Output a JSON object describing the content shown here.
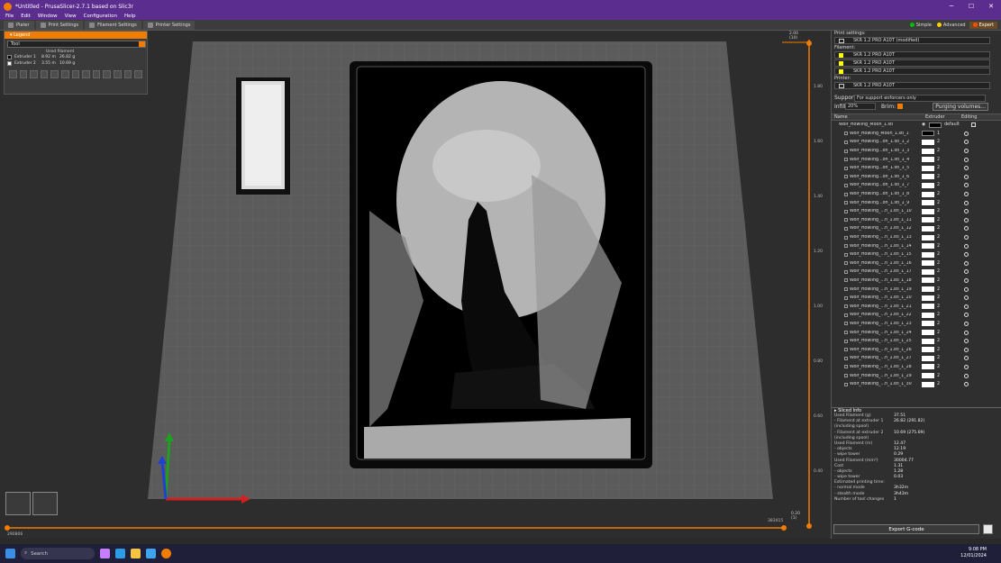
{
  "window": {
    "title": "*Untitled - PrusaSlicer-2.7.1 based on Slic3r"
  },
  "menu": [
    "File",
    "Edit",
    "Window",
    "View",
    "Configuration",
    "Help"
  ],
  "tabs": [
    "Plater",
    "Print Settings",
    "Filament Settings",
    "Printer Settings"
  ],
  "modes": {
    "simple": "Simple",
    "advanced": "Advanced",
    "expert": "Expert"
  },
  "colors": {
    "accent": "#f07d00",
    "titlebar": "#5b2d8e",
    "simple": "#00c000",
    "advanced": "#ffd000",
    "expert": "#ff4d00"
  },
  "legend": {
    "header": "Legend",
    "selector": "Tool",
    "used_header": "Used filament",
    "extruders": [
      {
        "label": "Extruder 1",
        "m": "8.92 m",
        "g": "26.82 g",
        "color": "#000000"
      },
      {
        "label": "Extruder 2",
        "m": "3.55 m",
        "g": "10.69 g",
        "color": "#ffffff"
      }
    ]
  },
  "vslider": {
    "ticks": [
      "2.00",
      "1.80",
      "1.60",
      "1.40",
      "1.20",
      "1.00",
      "0.80",
      "0.60",
      "0.40",
      "0.20"
    ],
    "top_label": "(10)",
    "bottom_label": "(1)"
  },
  "hslider": {
    "left": "290806",
    "right": "383415"
  },
  "print_settings": {
    "label": "Print settings:",
    "print": "SKR 1.2 PRO A10T (modified)",
    "filament_label": "Filament:",
    "filaments": [
      "SKR 1.2 PRO A10T",
      "SKR 1.2 PRO A10T",
      "SKR 1.2 PRO A10T"
    ],
    "printer_label": "Printer:",
    "printer": "SKR 1.2 PRO A10T",
    "supports_label": "Supports:",
    "supports": "For support enforcers only",
    "infill_label": "Infill:",
    "infill": "20%",
    "brim_label": "Brim:",
    "purging": "Purging volumes..."
  },
  "objects": {
    "headers": {
      "name": "Name",
      "extruder": "Extruder",
      "editing": "Editing"
    },
    "root": {
      "name": "Wolf_Howling_Moon_1.stl",
      "extruder": "default"
    },
    "items": [
      {
        "name": "Wolf_Howling_Moon_1.stl_1",
        "ext": "1",
        "black": true
      },
      {
        "name": "Wolf_Howling...on_1.stl_1_2",
        "ext": "2"
      },
      {
        "name": "Wolf_Howling...on_1.stl_1_3",
        "ext": "2"
      },
      {
        "name": "Wolf_Howling...on_1.stl_1_4",
        "ext": "2"
      },
      {
        "name": "Wolf_Howling...on_1.stl_1_5",
        "ext": "2"
      },
      {
        "name": "Wolf_Howling...on_1.stl_1_6",
        "ext": "2"
      },
      {
        "name": "Wolf_Howling...on_1.stl_1_7",
        "ext": "2"
      },
      {
        "name": "Wolf_Howling...on_1.stl_1_8",
        "ext": "2"
      },
      {
        "name": "Wolf_Howling...on_1.stl_1_9",
        "ext": "2"
      },
      {
        "name": "Wolf_Howling_...n_1.stl_1_10",
        "ext": "2"
      },
      {
        "name": "Wolf_Howling_...n_1.stl_1_11",
        "ext": "2"
      },
      {
        "name": "Wolf_Howling_...n_1.stl_1_12",
        "ext": "2"
      },
      {
        "name": "Wolf_Howling_...n_1.stl_1_13",
        "ext": "2"
      },
      {
        "name": "Wolf_Howling_...n_1.stl_1_14",
        "ext": "2"
      },
      {
        "name": "Wolf_Howling_...n_1.stl_1_15",
        "ext": "2"
      },
      {
        "name": "Wolf_Howling_...n_1.stl_1_16",
        "ext": "2"
      },
      {
        "name": "Wolf_Howling_...n_1.stl_1_17",
        "ext": "2"
      },
      {
        "name": "Wolf_Howling_...n_1.stl_1_18",
        "ext": "2"
      },
      {
        "name": "Wolf_Howling_...n_1.stl_1_19",
        "ext": "2"
      },
      {
        "name": "Wolf_Howling_...n_1.stl_1_20",
        "ext": "2"
      },
      {
        "name": "Wolf_Howling_...n_1.stl_1_21",
        "ext": "2"
      },
      {
        "name": "Wolf_Howling_...n_1.stl_1_22",
        "ext": "2"
      },
      {
        "name": "Wolf_Howling_...n_1.stl_1_23",
        "ext": "2"
      },
      {
        "name": "Wolf_Howling_...n_1.stl_1_24",
        "ext": "2"
      },
      {
        "name": "Wolf_Howling_...n_1.stl_1_25",
        "ext": "2"
      },
      {
        "name": "Wolf_Howling_...n_1.stl_1_26",
        "ext": "2"
      },
      {
        "name": "Wolf_Howling_...n_1.stl_1_27",
        "ext": "2"
      },
      {
        "name": "Wolf_Howling_...n_1.stl_1_28",
        "ext": "2"
      },
      {
        "name": "Wolf_Howling_...n_1.stl_1_29",
        "ext": "2"
      },
      {
        "name": "Wolf_Howling_...n_1.stl_1_30",
        "ext": "2"
      }
    ]
  },
  "sliced_info": {
    "header": "Sliced Info",
    "rows": [
      {
        "k": "Used Filament (g)",
        "v": "37.51"
      },
      {
        "k": "  - Filament at extruder 1",
        "v": "26.82 (291.82)"
      },
      {
        "k": "    (including spool)",
        "v": ""
      },
      {
        "k": "  - Filament at extruder 2",
        "v": "10.69 (275.69)"
      },
      {
        "k": "    (including spool)",
        "v": ""
      },
      {
        "k": "Used Filament (m)",
        "v": "12.47"
      },
      {
        "k": "  - objects",
        "v": "12.19"
      },
      {
        "k": "  - wipe tower",
        "v": "0.29"
      },
      {
        "k": "Used Filament (mm³)",
        "v": "30004.77"
      },
      {
        "k": "Cost",
        "v": "1.31"
      },
      {
        "k": "  - objects",
        "v": "1.28"
      },
      {
        "k": "  - wipe tower",
        "v": "0.03"
      },
      {
        "k": "Estimated printing time:",
        "v": ""
      },
      {
        "k": "  - normal mode",
        "v": "3h32m"
      },
      {
        "k": "  - stealth mode",
        "v": "3h43m"
      },
      {
        "k": "Number of tool changes",
        "v": "1"
      }
    ]
  },
  "export_label": "Export G-code",
  "taskbar": {
    "search": "Search",
    "time": "9:08 PM",
    "date": "12/01/2024"
  }
}
